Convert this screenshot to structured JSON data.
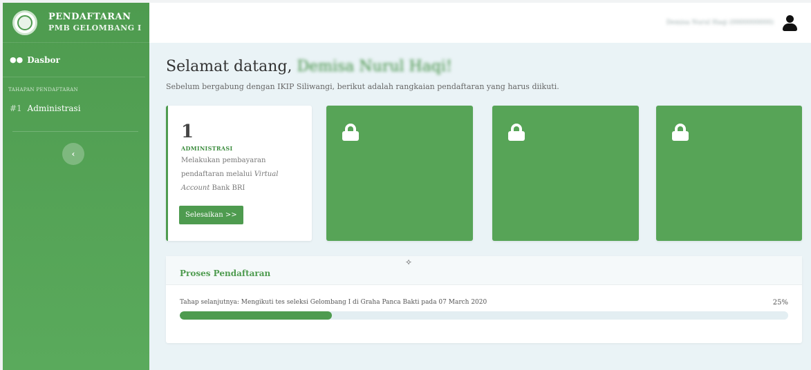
{
  "sidebar": {
    "brand_title": "PENDAFTARAN",
    "brand_subtitle": "PMB GELOMBANG I",
    "nav_dashboard_label": "Dasbor",
    "section_heading": "TAHAPAN PENDAFTARAN",
    "steps": [
      {
        "number": "#1",
        "label": "Administrasi"
      }
    ],
    "collapse_icon": "chevron-left-icon",
    "collapse_glyph": "‹"
  },
  "topbar": {
    "user_name": "Demisa Nurul Haqi (0000000000)",
    "user_icon": "user-icon"
  },
  "main": {
    "welcome_prefix": "Selamat datang, ",
    "welcome_name": "Demisa Nurul Haqi!",
    "subtitle": "Sebelum bergabung dengan IKIP Siliwangi, berikut adalah rangkaian pendaftaran yang harus diikuti.",
    "active_step": {
      "number": "1",
      "title": "ADMINISTRASI",
      "desc_before": "Melakukan pembayaran pendaftaran melalui ",
      "desc_italic": "Virtual Account",
      "desc_after": " Bank BRI",
      "button_label": "Selesaikan >>"
    },
    "locked_steps": [
      {
        "icon": "lock-icon"
      },
      {
        "icon": "lock-icon"
      },
      {
        "icon": "lock-icon"
      }
    ],
    "progress": {
      "title": "Proses Pendaftaran",
      "text": "Tahap selanjutnya: Mengikuti tes seleksi Gelombang I di Graha Panca Bakti pada 07 March 2020",
      "percent_label": "25%",
      "value": 0.25
    }
  },
  "colors": {
    "primary_green": "#4e9b4f",
    "locked_card_green": "#57a457",
    "background": "#eaf3f6"
  }
}
